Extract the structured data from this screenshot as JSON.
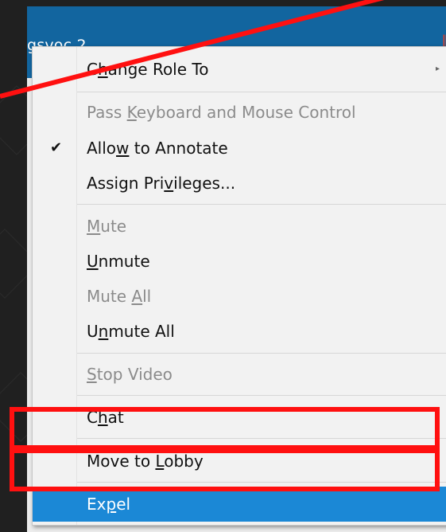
{
  "app": {
    "title_fragment": "gsvoc 2",
    "title_mark": "∥"
  },
  "menu": {
    "items": [
      {
        "id": "change-role",
        "label": "Change Role To",
        "mnemonic": "h",
        "enabled": true,
        "has_submenu": true,
        "checked": false,
        "highlighted": false
      },
      {
        "id": "pass-control",
        "label": "Pass Keyboard and Mouse Control",
        "mnemonic": "K",
        "enabled": false,
        "has_submenu": false,
        "checked": false,
        "highlighted": false
      },
      {
        "id": "allow-annotate",
        "label": "Allow to Annotate",
        "mnemonic": "w",
        "enabled": true,
        "has_submenu": false,
        "checked": true,
        "highlighted": false
      },
      {
        "id": "assign-privileges",
        "label": "Assign Privileges...",
        "mnemonic": "v",
        "enabled": true,
        "has_submenu": false,
        "checked": false,
        "highlighted": false
      },
      {
        "id": "mute",
        "label": "Mute",
        "mnemonic": "M",
        "enabled": false,
        "has_submenu": false,
        "checked": false,
        "highlighted": false
      },
      {
        "id": "unmute",
        "label": "Unmute",
        "mnemonic": "U",
        "enabled": true,
        "has_submenu": false,
        "checked": false,
        "highlighted": false
      },
      {
        "id": "mute-all",
        "label": "Mute All",
        "mnemonic": "A",
        "enabled": false,
        "has_submenu": false,
        "checked": false,
        "highlighted": false
      },
      {
        "id": "unmute-all",
        "label": "Unmute All",
        "mnemonic": "n",
        "enabled": true,
        "has_submenu": false,
        "checked": false,
        "highlighted": false
      },
      {
        "id": "stop-video",
        "label": "Stop Video",
        "mnemonic": "S",
        "enabled": false,
        "has_submenu": false,
        "checked": false,
        "highlighted": false
      },
      {
        "id": "chat",
        "label": "Chat",
        "mnemonic": "h",
        "enabled": true,
        "has_submenu": false,
        "checked": false,
        "highlighted": false
      },
      {
        "id": "move-to-lobby",
        "label": "Move to Lobby",
        "mnemonic": "L",
        "enabled": true,
        "has_submenu": false,
        "checked": false,
        "highlighted": false
      },
      {
        "id": "expel",
        "label": "Expel",
        "mnemonic": "p",
        "enabled": true,
        "has_submenu": false,
        "checked": false,
        "highlighted": true
      }
    ],
    "check_glyph": "✔",
    "submenu_glyph": "▸"
  },
  "colors": {
    "annotation_red": "#ff1010",
    "highlight_blue": "#1b88d6",
    "title_blue": "#12659f"
  }
}
